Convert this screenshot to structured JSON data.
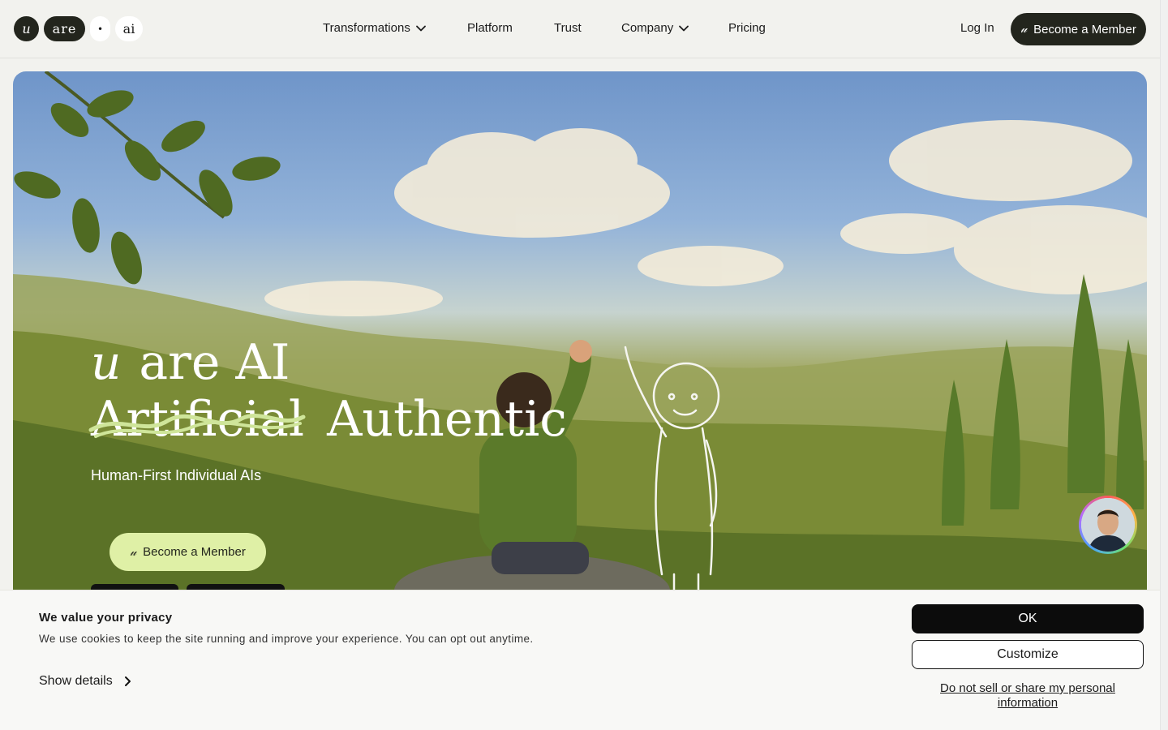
{
  "header": {
    "logo": {
      "mark": "u",
      "word": "are",
      "dot": "•",
      "ai": "ai"
    },
    "nav": [
      {
        "label": "Transformations",
        "has_dropdown": true
      },
      {
        "label": "Platform",
        "has_dropdown": false
      },
      {
        "label": "Trust",
        "has_dropdown": false
      },
      {
        "label": "Company",
        "has_dropdown": true
      },
      {
        "label": "Pricing",
        "has_dropdown": false
      }
    ],
    "login_label": "Log In",
    "member_button_label": "Become a Member"
  },
  "hero": {
    "title_mark": "u",
    "title_line1": "are AI",
    "struck_word": "Artificial",
    "replacement_word": "Authentic",
    "subtitle": "Human-First Individual AIs",
    "cta_label": "Become a Member",
    "accent_color": "#dff0a6"
  },
  "cookie_banner": {
    "title": "We value your privacy",
    "text": "We use cookies to keep the site running and improve your experience. You can opt out anytime.",
    "show_details_label": "Show details",
    "ok_label": "OK",
    "customize_label": "Customize",
    "do_not_sell_label": "Do not sell or share my personal information"
  },
  "colors": {
    "dark": "#23251d",
    "button_black": "#0c0c0c",
    "background": "#f2f2ee"
  }
}
